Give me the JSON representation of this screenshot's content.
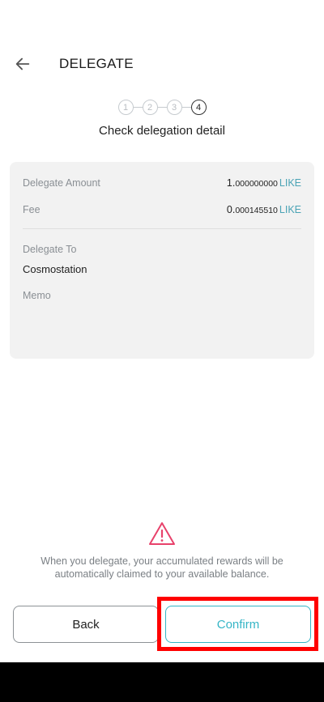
{
  "header": {
    "title": "DELEGATE",
    "back_icon": "arrow-left-icon"
  },
  "stepper": {
    "steps": [
      "1",
      "2",
      "3",
      "4"
    ],
    "active_step": 4,
    "caption": "Check delegation detail"
  },
  "details": {
    "amount_label": "Delegate Amount",
    "amount_int": "1.",
    "amount_dec": "000000000",
    "amount_denom": "LIKE",
    "fee_label": "Fee",
    "fee_int": "0.",
    "fee_dec": "000145510",
    "fee_denom": "LIKE",
    "delegate_to_label": "Delegate To",
    "validator_name": "Cosmostation",
    "memo_label": "Memo"
  },
  "notice": {
    "icon": "warning-triangle-icon",
    "text": "When you delegate, your accumulated rewards will be automatically claimed to your available balance."
  },
  "buttons": {
    "back_label": "Back",
    "confirm_label": "Confirm"
  },
  "colors": {
    "accent": "#35b5c6",
    "warning": "#e8426b",
    "highlight": "#ff0000"
  }
}
